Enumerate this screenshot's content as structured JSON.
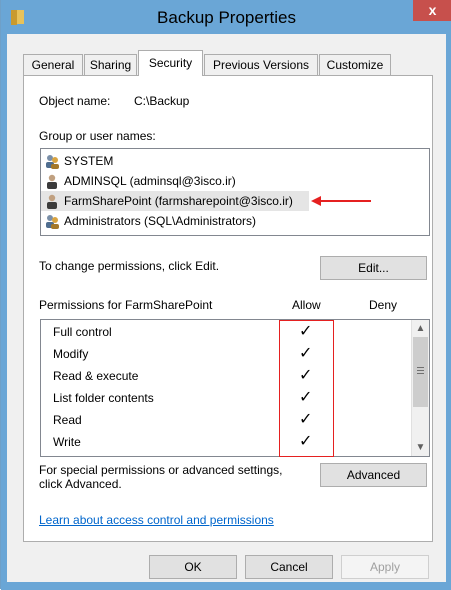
{
  "window": {
    "title": "Backup Properties",
    "close_label": "x"
  },
  "tabs": [
    "General",
    "Sharing",
    "Security",
    "Previous Versions",
    "Customize"
  ],
  "object": {
    "label": "Object name:",
    "value": "C:\\Backup"
  },
  "groups": {
    "label": "Group or user names:",
    "items": [
      "SYSTEM",
      "ADMINSQL (adminsql@3isco.ir)",
      "FarmSharePoint (farmsharepoint@3isco.ir)",
      "Administrators (SQL\\Administrators)"
    ],
    "selected_index": 2
  },
  "change_text": "To change permissions, click Edit.",
  "edit_label": "Edit...",
  "permissions": {
    "label": "Permissions for FarmSharePoint",
    "allow_header": "Allow",
    "deny_header": "Deny",
    "items": [
      "Full control",
      "Modify",
      "Read & execute",
      "List folder contents",
      "Read",
      "Write"
    ],
    "check_glyph": "✓"
  },
  "special_text_1": "For special permissions or advanced settings,",
  "special_text_2": "click Advanced.",
  "advanced_label": "Advanced",
  "learn_link": "Learn about access control and permissions",
  "buttons": {
    "ok": "OK",
    "cancel": "Cancel",
    "apply": "Apply"
  },
  "colors": {
    "accent": "#6aa6d6",
    "highlight": "#e52020",
    "link": "#0066cc"
  }
}
